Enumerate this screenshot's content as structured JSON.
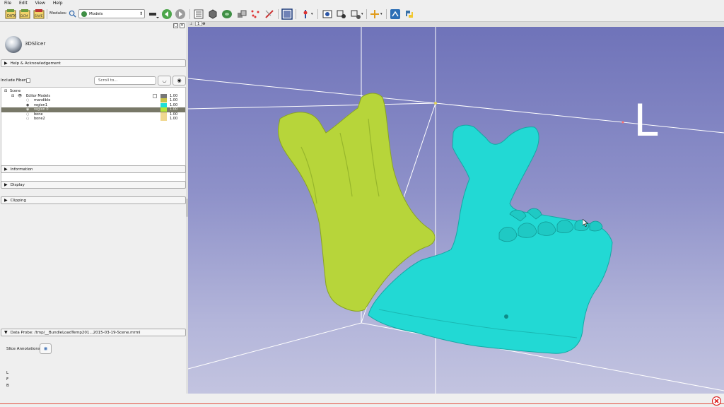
{
  "menu": [
    "File",
    "Edit",
    "View",
    "Help"
  ],
  "toolbar": {
    "modules_label": "Modules:",
    "module_selected": "Models",
    "load_data_icon": "load-data-icon",
    "dicom_icon": "dicom-icon",
    "save_icon": "save-icon"
  },
  "panel": {
    "app_name": "3DSlicer",
    "sections": {
      "help": "Help & Acknowledgement",
      "information": "Information",
      "display": "Display",
      "clipping": "Clipping"
    },
    "include_fibers": "Include Fibers",
    "scroll_placeholder": "Scroll to...",
    "tree": {
      "scene": "Scene",
      "editor_models": "Editor Models",
      "editor_models_opacity": "1.00",
      "items": [
        {
          "name": "mandible",
          "opacity": "1.00",
          "color": "#c9c24a"
        },
        {
          "name": "region1",
          "opacity": "1.00",
          "color": "#1fe0d8"
        },
        {
          "name": "region 0",
          "opacity": "1.00",
          "color": "#b6e636"
        },
        {
          "name": "bone",
          "opacity": "1.00",
          "color": "#f0d890"
        },
        {
          "name": "bone2",
          "opacity": "1.00",
          "color": "#f0d890"
        }
      ],
      "editor_models_color": "#777777"
    },
    "data_probe": "Data Probe: /tmp/__BundleLoadTemp201...2015-03-19-Scene.mrml",
    "slice_annotations": "Slice Annotations:",
    "probe_lines": [
      "L",
      "F",
      "B"
    ]
  },
  "view": {
    "number": "1",
    "orientation_label": "L",
    "background_top": "#6f73b9",
    "background_bottom": "#c3c4e0",
    "mandible_color": "#b7d53a",
    "region1_color": "#22d9d4"
  }
}
